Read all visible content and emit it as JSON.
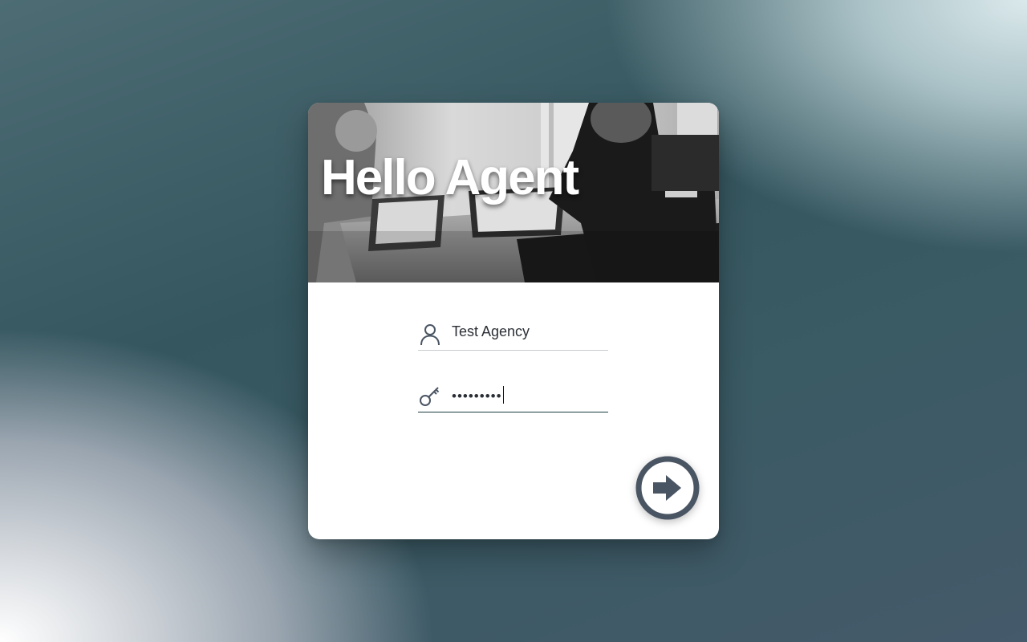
{
  "hero": {
    "title": "Hello Agent"
  },
  "login_form": {
    "username_value": "Test Agency",
    "password_masked": "•••••••••"
  },
  "icons": {
    "username": "user-icon",
    "password": "key-icon",
    "submit": "arrow-circle-right-icon"
  },
  "colors": {
    "icon": "#4a5563",
    "active_underline": "#1d3b3f",
    "submit": "#4a5563"
  }
}
